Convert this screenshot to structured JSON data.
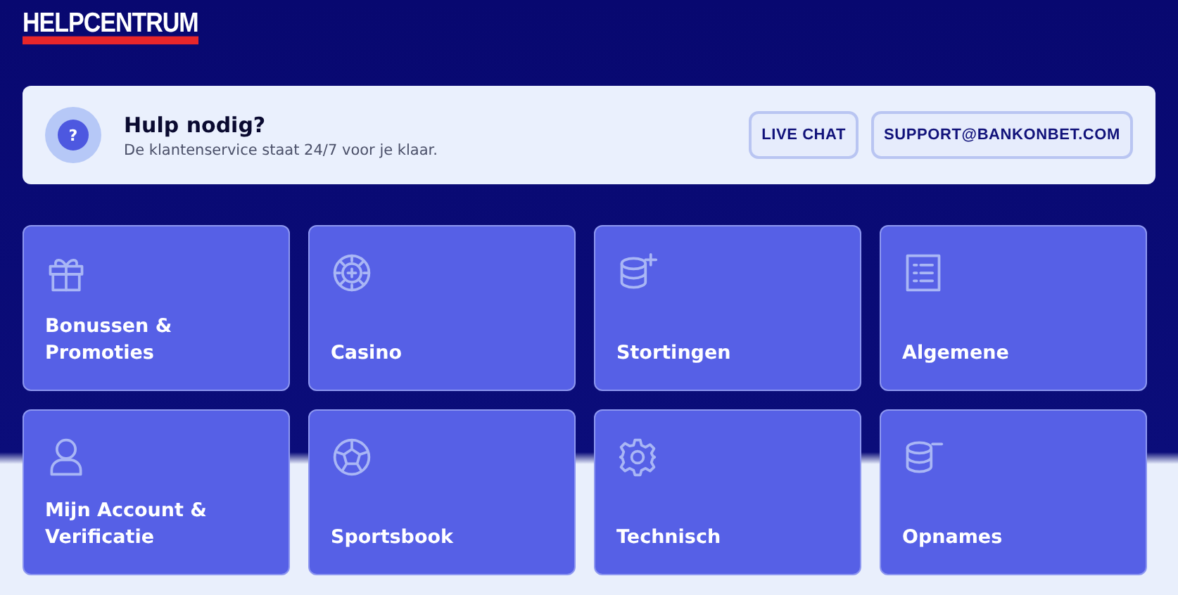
{
  "header": {
    "title": "HELPCENTRUM"
  },
  "help_banner": {
    "icon": "?",
    "title": "Hulp nodig?",
    "subtitle": "De klantenservice staat 24/7 voor je klaar.",
    "buttons": [
      "LIVE CHAT",
      "SUPPORT@BANKONBET.COM"
    ]
  },
  "categories": [
    {
      "kind": "gift",
      "label": "Bonussen & Promoties"
    },
    {
      "kind": "chip",
      "label": "Casino"
    },
    {
      "kind": "coins-plus",
      "label": "Stortingen"
    },
    {
      "kind": "list",
      "label": "Algemene"
    },
    {
      "kind": "user",
      "label": "Mijn Account & Verificatie"
    },
    {
      "kind": "ball",
      "label": "Sportsbook"
    },
    {
      "kind": "gear",
      "label": "Technisch"
    },
    {
      "kind": "coins-minus",
      "label": "Opnames"
    }
  ]
}
